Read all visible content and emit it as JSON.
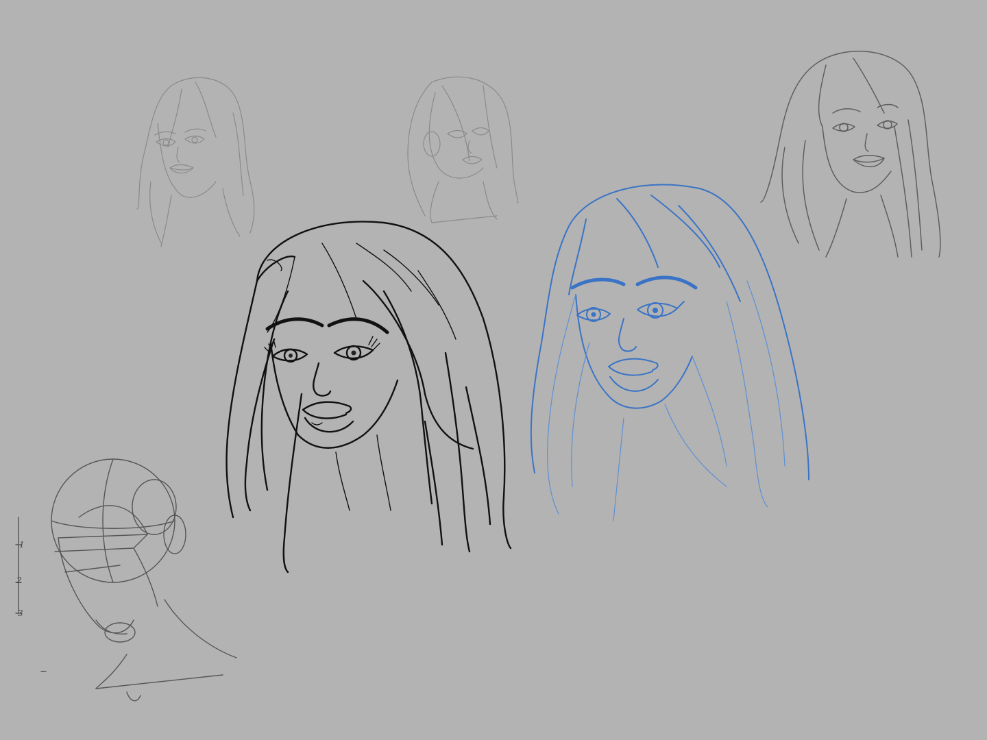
{
  "canvas": {
    "background": "#b3b3b3"
  },
  "colors": {
    "ink": "#111111",
    "blue_sketch": "#3a73c6",
    "faint_pencil": "#8a8a8a",
    "mid_pencil": "#5e5e5e"
  },
  "construction": {
    "scale_marks": [
      "1",
      "2",
      "3"
    ]
  }
}
